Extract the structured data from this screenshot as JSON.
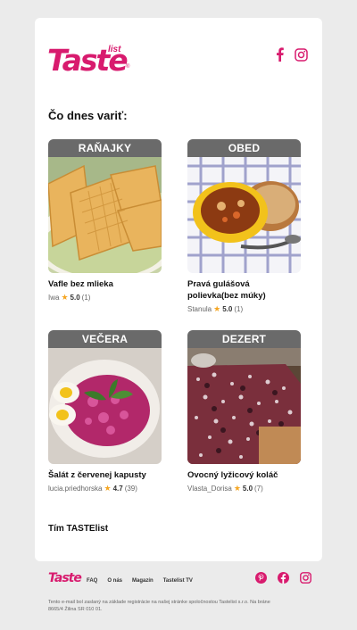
{
  "brand": {
    "logo_main": "Taste",
    "logo_sub": "list",
    "logo_reg": "®"
  },
  "header": {
    "social": [
      "facebook-icon",
      "instagram-icon"
    ]
  },
  "heading": "Čo dnes variť:",
  "recipes": [
    {
      "category": "RAŇAJKY",
      "title": "Vafle bez mlieka",
      "author": "Iwa",
      "rating": "5.0",
      "count": "(1)"
    },
    {
      "category": "OBED",
      "title": "Pravá gulášová polievka(bez múky)",
      "author": "Stanula",
      "rating": "5.0",
      "count": "(1)"
    },
    {
      "category": "VEČERA",
      "title": "Šalát z červenej kapusty",
      "author": "lucia.priedhorska",
      "rating": "4.7",
      "count": "(39)"
    },
    {
      "category": "DEZERT",
      "title": "Ovocný lyžicový koláč",
      "author": "Vlasta_Dorisa",
      "rating": "5.0",
      "count": "(7)"
    }
  ],
  "signature": "Tím TASTElist",
  "footer": {
    "logo": "Taste",
    "links": [
      "FAQ",
      "O nás",
      "Magazín",
      "Tastelist TV"
    ],
    "social": [
      "pinterest-icon",
      "facebook-icon",
      "instagram-icon"
    ],
    "legal": "Tento e-mail bol zaslaný na základe registrácie na našej stránke spoločnostou Tastelist s.r.o. Na bráne 8665/4 Žilina SR 010 01."
  },
  "colors": {
    "brand": "#d81b6e",
    "tag_bg": "#6a6a6a",
    "star": "#f5a623",
    "page_bg": "#ebebeb"
  }
}
